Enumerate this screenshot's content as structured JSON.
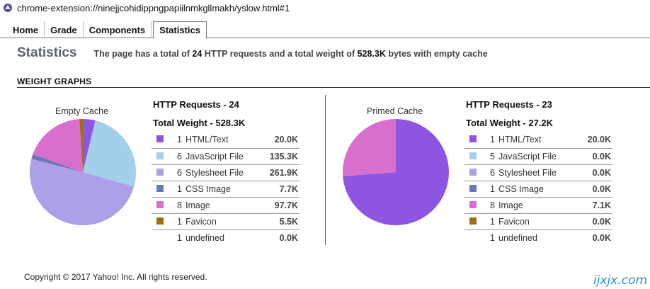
{
  "window": {
    "url": "chrome-extension://ninejjcohidippngpapiilnmkgllmakh/yslow.html#1"
  },
  "tabs": [
    {
      "label": "Home"
    },
    {
      "label": "Grade"
    },
    {
      "label": "Components"
    },
    {
      "label": "Statistics"
    }
  ],
  "active_tab": "Statistics",
  "statistics": {
    "title": "Statistics",
    "desc_prefix": "The page has a total of ",
    "total_requests": "24",
    "desc_middle": " HTTP requests and a total weight of ",
    "total_weight": "528.3K",
    "desc_suffix": " bytes with empty cache"
  },
  "section_title": "WEIGHT GRAPHS",
  "colors": {
    "html": "#8e56e0",
    "js": "#a3cfea",
    "css": "#ad9fe8",
    "cssimage": "#6c75b5",
    "image": "#d86fcd",
    "favicon": "#9e6f12"
  },
  "empty_cache": {
    "label": "Empty Cache",
    "requests_text": "HTTP Requests - 24",
    "weight_text": "Total Weight - 528.3K",
    "rows": [
      {
        "count": "1",
        "name": "HTML/Text",
        "value": "20.0K",
        "color": "#8e56e0"
      },
      {
        "count": "6",
        "name": "JavaScript File",
        "value": "135.3K",
        "color": "#a3cfea"
      },
      {
        "count": "6",
        "name": "Stylesheet File",
        "value": "261.9K",
        "color": "#ad9fe8"
      },
      {
        "count": "1",
        "name": "CSS Image",
        "value": "7.7K",
        "color": "#6c75b5"
      },
      {
        "count": "8",
        "name": "Image",
        "value": "97.7K",
        "color": "#d86fcd"
      },
      {
        "count": "1",
        "name": "Favicon",
        "value": "5.5K",
        "color": "#9e6f12"
      },
      {
        "count": "1",
        "name": "undefined",
        "value": "0.0K",
        "color": ""
      }
    ],
    "pie": [
      20.0,
      135.3,
      261.9,
      7.7,
      97.7,
      5.5
    ]
  },
  "primed_cache": {
    "label": "Primed Cache",
    "requests_text": "HTTP Requests - 23",
    "weight_text": "Total Weight - 27.2K",
    "rows": [
      {
        "count": "1",
        "name": "HTML/Text",
        "value": "20.0K",
        "color": "#8e56e0"
      },
      {
        "count": "5",
        "name": "JavaScript File",
        "value": "0.0K",
        "color": "#a3cfea"
      },
      {
        "count": "6",
        "name": "Stylesheet File",
        "value": "0.0K",
        "color": "#ad9fe8"
      },
      {
        "count": "1",
        "name": "CSS Image",
        "value": "0.0K",
        "color": "#6c75b5"
      },
      {
        "count": "8",
        "name": "Image",
        "value": "7.1K",
        "color": "#d86fcd"
      },
      {
        "count": "1",
        "name": "Favicon",
        "value": "0.0K",
        "color": "#9e6f12"
      },
      {
        "count": "1",
        "name": "undefined",
        "value": "0.0K",
        "color": ""
      }
    ],
    "pie": [
      20.0,
      0,
      0,
      0,
      7.1,
      0
    ]
  },
  "footer": "Copyright © 2017 Yahoo! Inc. All rights reserved.",
  "watermark": "ijxjx.com"
}
